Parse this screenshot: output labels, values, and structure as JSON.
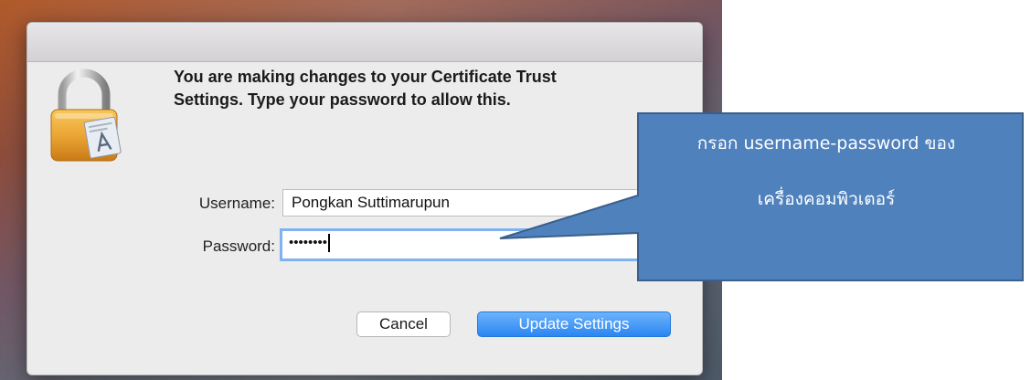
{
  "dialog": {
    "message_line1": "You are making changes to your Certificate Trust",
    "message_line2": "Settings. Type your password to allow this.",
    "username_label": "Username:",
    "username_value": "Pongkan Suttimarupun",
    "password_label": "Password:",
    "password_value": "••••••••",
    "cancel_label": "Cancel",
    "update_label": "Update Settings",
    "icon": "lock-icon"
  },
  "callout": {
    "line1": "กรอก username-password ของ",
    "line2": "เครื่องคอมพิวเตอร์",
    "fill_color": "#4f81bd",
    "border_color": "#3a5f8a"
  },
  "colors": {
    "primary_button": "#2a86f2",
    "focus_ring": "#7eb2f2",
    "dialog_bg": "#ececec"
  }
}
